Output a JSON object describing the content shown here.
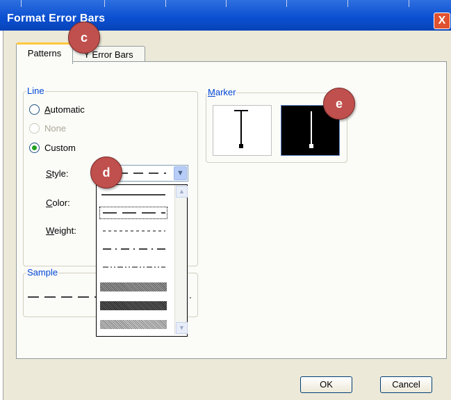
{
  "window": {
    "title": "Format Error Bars",
    "close_glyph": "X"
  },
  "tabs": [
    {
      "label": "Patterns",
      "active": true
    },
    {
      "label": "Y Error Bars",
      "active": false
    }
  ],
  "line_group": {
    "label": "Line",
    "automatic_label": "Automatic",
    "none_label": "None",
    "custom_label": "Custom",
    "selected": "Custom",
    "style_label": "Style:",
    "color_label": "Color:",
    "weight_label": "Weight:",
    "style_options": [
      "solid",
      "long-dash",
      "dashed",
      "dash-dot",
      "dash-dot-dot",
      "fine-pattern",
      "dark-pattern",
      "light-pattern"
    ],
    "style_selected": "long-dash"
  },
  "sample_group": {
    "label": "Sample"
  },
  "marker_group": {
    "label": "Marker",
    "options": [
      "cap-marker-light",
      "cap-marker-dark"
    ],
    "selected": "cap-marker-dark"
  },
  "buttons": {
    "ok": "OK",
    "cancel": "Cancel"
  },
  "callouts": {
    "c": "c",
    "d": "d",
    "e": "e"
  },
  "colors": {
    "titlebar": "#0a4fd0",
    "callout": "#c0504d",
    "radio_dot": "#21a121",
    "group_label": "#0046d5"
  }
}
